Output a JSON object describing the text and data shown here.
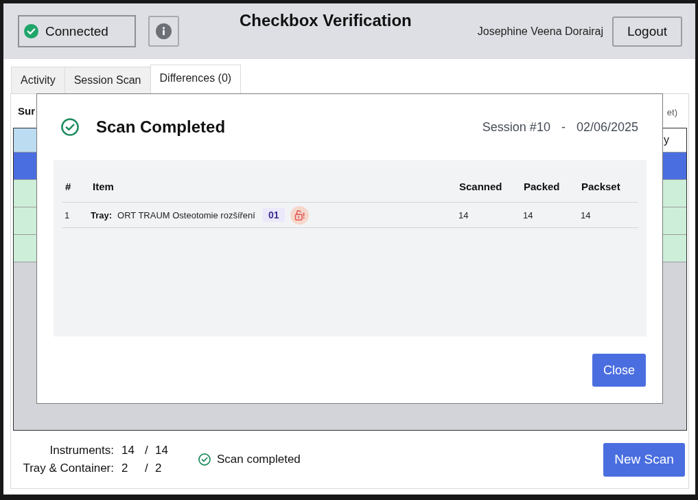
{
  "header": {
    "connection": {
      "label": "Connected",
      "connected": true
    },
    "title": "Checkbox Verification",
    "user_name": "Josephine Veena Dorairaj",
    "logout_button": "Logout"
  },
  "tabs": [
    {
      "label": "Activity",
      "selected": false
    },
    {
      "label": "Session Scan",
      "selected": false
    },
    {
      "label": "Differences (0)",
      "selected": true
    }
  ],
  "summary": {
    "heading": "Sur",
    "note": "et)",
    "table": {
      "column_last": "y",
      "rows": [
        {
          "selected": true
        },
        {
          "selected": false
        },
        {
          "selected": false
        },
        {
          "selected": false
        }
      ]
    }
  },
  "footer": {
    "counts": [
      {
        "label": "Instruments:",
        "done": "14",
        "separator": "/",
        "total": "14"
      },
      {
        "label": "Tray & Container:",
        "done": "2",
        "separator": "/",
        "total": "2"
      }
    ],
    "status": "Scan completed",
    "new_scan_button": "New Scan"
  },
  "dialog": {
    "title": "Scan Completed",
    "session": "Session #10",
    "separator": "-",
    "date": "02/06/2025",
    "columns": [
      "#",
      "Item",
      "Scanned",
      "Packed",
      "Packset"
    ],
    "rows": [
      {
        "index": "1",
        "type_label": "Tray:",
        "name": "ORT TRAUM Osteotomie rozšíření",
        "badge": "01",
        "sealed": false,
        "scanned": "14",
        "packed": "14",
        "packset": "14"
      }
    ],
    "close_button": "Close"
  }
}
